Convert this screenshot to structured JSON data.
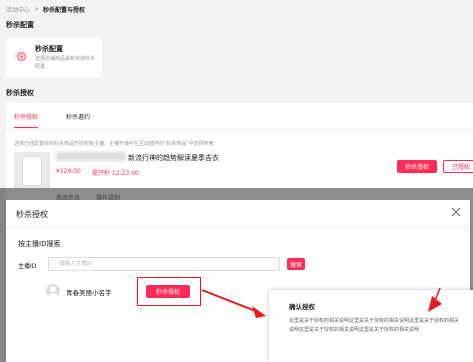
{
  "breadcrumb": {
    "parent": "活动中心",
    "separator": ">",
    "current": "秒杀配置与授权"
  },
  "config_section": {
    "title": "秒杀配置",
    "card": {
      "icon": "lightning-icon",
      "title": "秒杀配置",
      "desc": "选择店铺商品最新完成秒杀配置"
    }
  },
  "auth_section": {
    "title": "秒杀授权",
    "tabs": [
      {
        "label": "秒杀授权",
        "active": true
      },
      {
        "label": "秒杀邀约",
        "active": false
      }
    ],
    "hint": "选择已经配置好的秒杀商品开授权给主播，主播开播可在互动插件的\"秒杀商品\"中选择搜索",
    "product": {
      "title": "新流行神的趋势解读夏季吉衣",
      "price": "¥120.00",
      "time": "提开秒 12:23:00",
      "auth_button": "秒杀授权",
      "authorized_button": "已授权"
    },
    "below_overlay": [
      "商品信息",
      "操作规划"
    ]
  },
  "modal": {
    "title": "秒杀授权",
    "subtitle": "按主播ID搜索",
    "field_label": "主播ID",
    "input_placeholder": "请输入主播ID",
    "input_value": "",
    "search_button": "搜索",
    "result": {
      "name": "青春美丽小名字",
      "auth_button": "秒杀授权"
    }
  },
  "confirm_popup": {
    "title": "确认授权",
    "body": "这里是关于授权的相关说明这里是关于授权的相关说明这里是关于授权的相关说明这里是关于授权的相关说明这里是关于授权的相关说明"
  },
  "colors": {
    "accent": "#fe2c55",
    "highlight": "#e81a1a"
  }
}
